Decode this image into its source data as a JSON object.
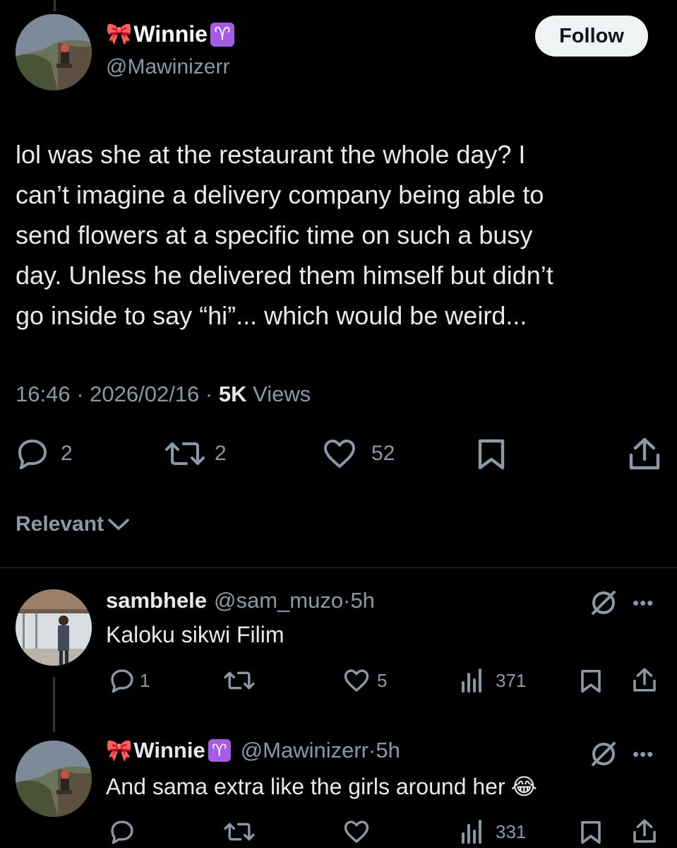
{
  "main_tweet": {
    "bow_emoji": "🎀",
    "display_name": "Winnie",
    "zodiac": "♈",
    "handle": "@Mawinizerr",
    "follow_label": "Follow",
    "text": "lol was she at the restaurant the whole day? I\ncan’t imagine a delivery company being able to\nsend flowers at a specific time on such a busy\nday. Unless he delivered them himself but didn’t\ngo inside to say “hi”... which would be weird...",
    "time": "16:46",
    "date": "2026/02/16",
    "views_count": "5K",
    "views_label": "Views",
    "reply_count": "2",
    "retweet_count": "2",
    "like_count": "52"
  },
  "sort_label": "Relevant",
  "replies": [
    {
      "display_name": "sambhele",
      "handle": "@sam_muzo",
      "age": "5h",
      "text": "Kaloku sikwi Filim",
      "reply_count": "1",
      "retweet_count": "",
      "like_count": "5",
      "views": "371"
    },
    {
      "bow_emoji": "🎀",
      "display_name": "Winnie",
      "zodiac": "♈",
      "handle": "@Mawinizerr",
      "age": "5h",
      "text": "And sama extra like the girls around her",
      "emoji": "😂",
      "reply_count": "",
      "retweet_count": "",
      "like_count": "",
      "views": "331"
    }
  ],
  "colors": {
    "background": "#000000",
    "text": "#e7e9ea",
    "muted": "#8b98a5",
    "zodiac_badge": "#a55be6",
    "follow_bg": "#eff3f4"
  }
}
